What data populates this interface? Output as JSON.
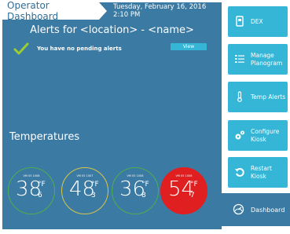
{
  "header": {
    "title": "Operator Dashboard",
    "datetime": "Tuesday, February 16, 2016 2:10 PM"
  },
  "alerts": {
    "title": "Alerts for <location> - <name>",
    "message": "You have no pending alerts",
    "view_label": "View"
  },
  "temperatures": {
    "title": "Temperatures",
    "gauges": [
      {
        "label": "VM 05 1008",
        "whole": "38",
        "decimal": "6",
        "unit": "°F",
        "ring_color": "#4fae4f",
        "fill": "transparent"
      },
      {
        "label": "VM 05 1007",
        "whole": "48",
        "decimal": "3",
        "unit": "°F",
        "ring_color": "#d8c64a",
        "fill": "transparent"
      },
      {
        "label": "VM 05 1008",
        "whole": "36",
        "decimal": "8",
        "unit": "°F",
        "ring_color": "#4fae4f",
        "fill": "transparent"
      },
      {
        "label": "VM 05 1008",
        "whole": "54",
        "decimal": "7",
        "unit": "°F",
        "ring_color": "#e02020",
        "fill": "#e02020"
      }
    ]
  },
  "sidebar": {
    "items": [
      {
        "label": "DEX",
        "icon": "card-icon"
      },
      {
        "label": "Manage Planogram",
        "icon": "list-icon"
      },
      {
        "label": "Temp Alerts",
        "icon": "thermometer-icon"
      },
      {
        "label": "Configure Kiosk",
        "icon": "gears-icon"
      },
      {
        "label": "Restart Kiosk",
        "icon": "restart-icon"
      }
    ],
    "dashboard_label": "Dashboard",
    "dashboard_icon": "dashboard-gauge-icon"
  },
  "colors": {
    "main_bg": "#3b7aa3",
    "accent": "#35b6d6",
    "check": "#9acd32"
  }
}
